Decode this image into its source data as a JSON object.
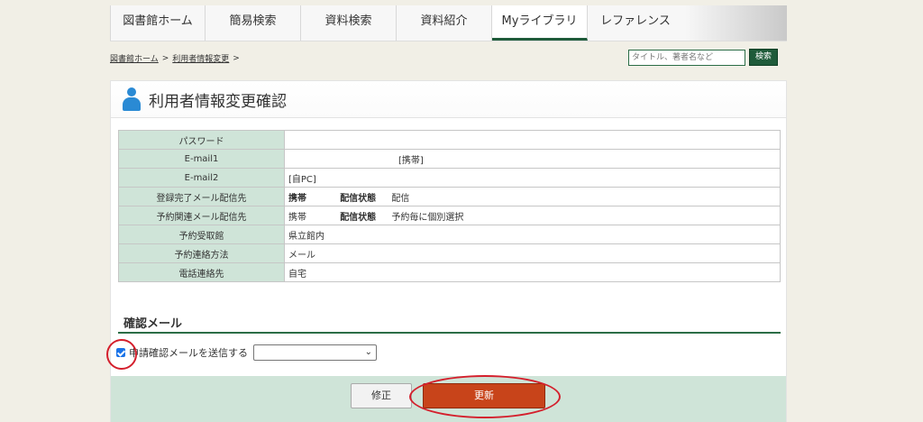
{
  "nav": {
    "tabs": [
      "図書館ホーム",
      "簡易検索",
      "資料検索",
      "資料紹介",
      "Myライブラリ",
      "レファレンス"
    ]
  },
  "breadcrumb": {
    "home": "図書館ホーム",
    "sep1": ">",
    "current": "利用者情報変更",
    "sep2": ">"
  },
  "search": {
    "placeholder": "タイトル、著者名など",
    "button": "検索"
  },
  "page": {
    "title": "利用者情報変更確認"
  },
  "table": {
    "rows": [
      {
        "label": "パスワード",
        "value": ""
      },
      {
        "label": "E-mail1",
        "value": "[携帯]"
      },
      {
        "label": "E-mail2",
        "value": "[自PC]"
      },
      {
        "label": "登録完了メール配信先",
        "v1": "携帯",
        "v2": "配信状態",
        "v3": "配信"
      },
      {
        "label": "予約関連メール配信先",
        "v1": "携帯",
        "v2": "配信状態",
        "v3": "予約毎に個別選択"
      },
      {
        "label": "予約受取館",
        "value": "県立館内"
      },
      {
        "label": "予約連絡方法",
        "value": "メール"
      },
      {
        "label": "電話連絡先",
        "value": "自宅"
      }
    ]
  },
  "confirm": {
    "heading": "確認メール",
    "checkbox_label": "申請確認メールを送信する",
    "select_value": ""
  },
  "buttons": {
    "fix": "修正",
    "update": "更新"
  },
  "colors": {
    "accent_green": "#1f5b3a",
    "update_orange": "#c8441a",
    "highlight_red": "#d41f2c"
  }
}
